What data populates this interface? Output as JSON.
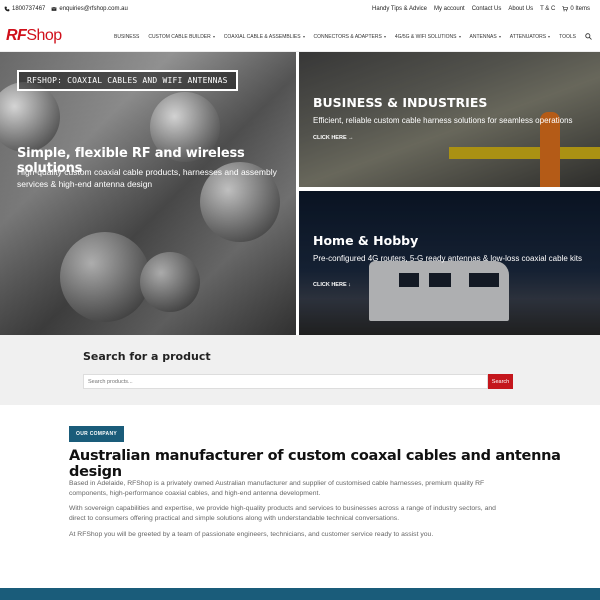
{
  "topbar": {
    "phone": "1800737467",
    "email": "enquiries@rfshop.com.au",
    "links": [
      "Handy Tips & Advice",
      "My account",
      "Contact Us",
      "About Us",
      "T & C"
    ],
    "cart": "0 Items"
  },
  "header": {
    "logo_rf": "RF",
    "logo_shop": "Shop",
    "nav": [
      {
        "label": "BUSINESS",
        "has_caret": false
      },
      {
        "label": "CUSTOM CABLE BUILDER",
        "has_caret": true
      },
      {
        "label": "COAXIAL CABLE & ASSEMBLIES",
        "has_caret": true
      },
      {
        "label": "CONNECTORS & ADAPTERS",
        "has_caret": true
      },
      {
        "label": "4G/5G & WIFI SOLUTIONS",
        "has_caret": true
      },
      {
        "label": "ANTENNAS",
        "has_caret": true
      },
      {
        "label": "ATTENUATORS",
        "has_caret": true
      },
      {
        "label": "TOOLS",
        "has_caret": false
      }
    ]
  },
  "hero": {
    "badge": "RFSHOP: COAXIAL CABLES AND WIFI ANTENNAS",
    "title": "Simple, flexible RF and wireless solutions",
    "subtitle": "High-quality custom coaxial cable products, harnesses and assembly services & high-end antenna design"
  },
  "panels": {
    "business": {
      "title": "BUSINESS & INDUSTRIES",
      "desc": "Efficient, reliable custom cable harness solutions for seamless operations",
      "cta": "CLICK HERE →"
    },
    "hobby": {
      "title": "Home & Hobby",
      "desc": "Pre-configured 4G routers, 5-G ready antennas & low-loss coaxial cable kits",
      "cta": "CLICK HERE ↓"
    }
  },
  "search": {
    "label": "Search for a product",
    "placeholder": "Search products...",
    "button": "Search"
  },
  "company": {
    "tag": "OUR COMPANY",
    "heading": "Australian manufacturer of custom coaxal cables and antenna design",
    "p1": "Based in Adelaide, RFShop is a privately owned Australian manufacturer and supplier of customised cable harnesses, premium quality RF components, high-performance coaxial cables, and high-end antenna development.",
    "p2": "With sovereign capabilities and expertise, we provide high-quality products and services to businesses across a range of industry sectors, and direct to consumers offering practical and simple solutions along with understandable technical conversations.",
    "p3": "At RFShop you will be greeted by a team of passionate engineers, technicians, and customer service ready to assist you."
  },
  "colors": {
    "brand_red": "#c4161c",
    "accent_blue": "#1a5c7a"
  },
  "icons": {
    "phone": "phone-icon",
    "email": "email-icon",
    "cart": "cart-icon",
    "search": "search-icon"
  }
}
